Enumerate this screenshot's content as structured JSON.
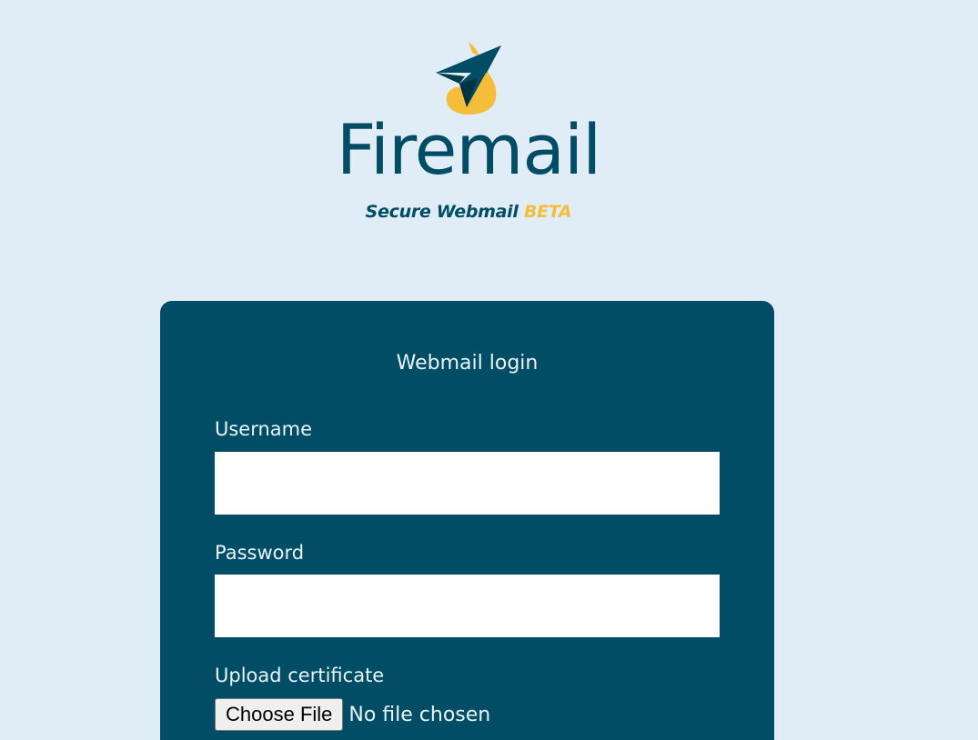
{
  "brand": {
    "name": "Firemail",
    "tagline": "Secure Webmail",
    "tagline_badge": "BETA",
    "logo_icon": "paper-plane-flame-icon",
    "colors": {
      "primary": "#004d65",
      "accent": "#f5bd3a",
      "background": "#e1edf6"
    }
  },
  "login": {
    "title": "Webmail login",
    "username": {
      "label": "Username",
      "value": ""
    },
    "password": {
      "label": "Password",
      "value": ""
    },
    "certificate": {
      "label": "Upload certificate",
      "button_label": "Choose File",
      "status": "No file chosen"
    }
  }
}
